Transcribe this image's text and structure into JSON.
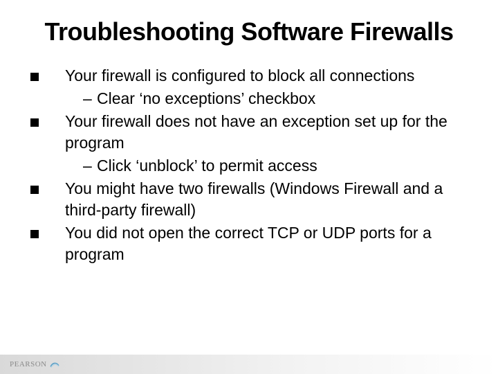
{
  "title": "Troubleshooting Software Firewalls",
  "bullets": [
    {
      "text": "Your firewall is configured to block all connections",
      "sub": [
        "Clear ‘no exceptions’ checkbox"
      ]
    },
    {
      "text": "Your firewall does not have an exception set up for the program",
      "sub": [
        "Click ‘unblock’ to permit access"
      ]
    },
    {
      "text": "You might have two firewalls (Windows Firewall and a third-party firewall)",
      "sub": []
    },
    {
      "text": "You did not open the correct TCP or UDP ports for a program",
      "sub": []
    }
  ],
  "footer": {
    "brand": "PEARSON"
  },
  "dash": "–"
}
